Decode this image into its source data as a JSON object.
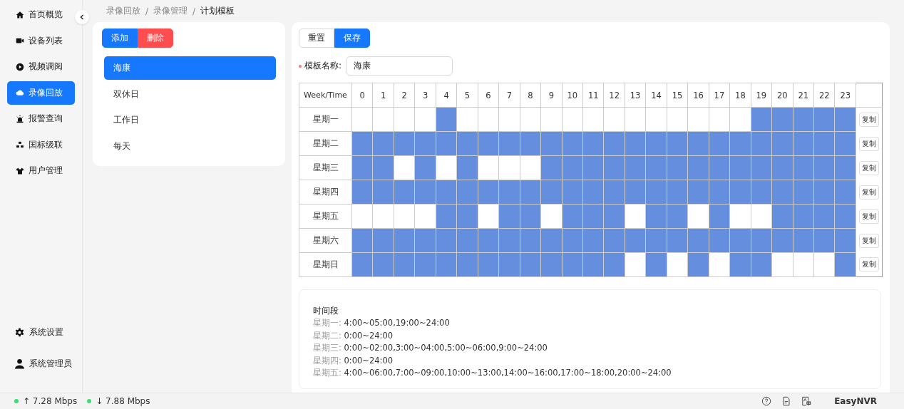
{
  "sidebar": {
    "items": [
      {
        "label": "首页概览",
        "selected": false
      },
      {
        "label": "设备列表",
        "selected": false
      },
      {
        "label": "视频调阅",
        "selected": false
      },
      {
        "label": "录像回放",
        "selected": true
      },
      {
        "label": "报警查询",
        "selected": false
      },
      {
        "label": "国标级联",
        "selected": false
      },
      {
        "label": "用户管理",
        "selected": false
      }
    ],
    "bottom_items": [
      {
        "label": "系统设置"
      },
      {
        "label": "系统管理员"
      }
    ]
  },
  "breadcrumb": [
    "录像回放",
    "/",
    "录像管理",
    "/",
    "计划模板"
  ],
  "template_list": {
    "buttons": [
      {
        "label": "添加",
        "kind": "primary"
      },
      {
        "label": "删除",
        "kind": "danger"
      }
    ],
    "items": [
      {
        "label": "海康",
        "selected": true
      },
      {
        "label": "双休日",
        "selected": false
      },
      {
        "label": "工作日",
        "selected": false
      },
      {
        "label": "每天",
        "selected": false
      }
    ]
  },
  "editor": {
    "buttons": [
      {
        "label": "重置",
        "kind": "default"
      },
      {
        "label": "保存",
        "kind": "primary"
      }
    ],
    "name_field": {
      "label": "模板名称:",
      "required": true,
      "value": "海康"
    },
    "schedule": {
      "corner": "Week/Time",
      "hours": [
        "0",
        "1",
        "2",
        "3",
        "4",
        "5",
        "6",
        "7",
        "8",
        "9",
        "10",
        "11",
        "12",
        "13",
        "14",
        "15",
        "16",
        "17",
        "18",
        "19",
        "20",
        "21",
        "22",
        "23"
      ],
      "rows": [
        {
          "day": "星期一",
          "copy": "复制",
          "slots": [
            false,
            false,
            false,
            false,
            true,
            false,
            false,
            false,
            false,
            false,
            false,
            false,
            false,
            false,
            false,
            false,
            false,
            false,
            false,
            true,
            true,
            true,
            true,
            true
          ]
        },
        {
          "day": "星期二",
          "copy": "复制",
          "slots": [
            true,
            true,
            true,
            true,
            true,
            true,
            true,
            true,
            true,
            true,
            true,
            true,
            true,
            true,
            true,
            true,
            true,
            true,
            true,
            true,
            true,
            true,
            true,
            true
          ]
        },
        {
          "day": "星期三",
          "copy": "复制",
          "slots": [
            true,
            true,
            false,
            true,
            false,
            true,
            false,
            false,
            false,
            true,
            true,
            true,
            true,
            true,
            true,
            true,
            true,
            true,
            true,
            true,
            true,
            true,
            true,
            true
          ]
        },
        {
          "day": "星期四",
          "copy": "复制",
          "slots": [
            true,
            true,
            true,
            true,
            true,
            true,
            true,
            true,
            true,
            true,
            true,
            true,
            true,
            true,
            true,
            true,
            true,
            true,
            true,
            true,
            true,
            true,
            true,
            true
          ]
        },
        {
          "day": "星期五",
          "copy": "复制",
          "slots": [
            false,
            false,
            false,
            false,
            true,
            true,
            false,
            true,
            true,
            false,
            true,
            true,
            true,
            false,
            true,
            true,
            false,
            true,
            false,
            false,
            true,
            true,
            true,
            true
          ]
        },
        {
          "day": "星期六",
          "copy": "复制",
          "slots": [
            true,
            true,
            true,
            true,
            true,
            true,
            true,
            true,
            true,
            true,
            true,
            true,
            true,
            true,
            true,
            true,
            true,
            true,
            true,
            true,
            true,
            true,
            true,
            true
          ]
        },
        {
          "day": "星期日",
          "copy": "复制",
          "slots": [
            true,
            true,
            true,
            true,
            true,
            true,
            true,
            true,
            true,
            true,
            true,
            true,
            true,
            false,
            true,
            false,
            true,
            false,
            true,
            true,
            false,
            false,
            false,
            true
          ]
        }
      ]
    },
    "summary": {
      "title": "时间段",
      "lines": [
        {
          "day": "星期一:",
          "ranges": "4:00~05:00,19:00~24:00"
        },
        {
          "day": "星期二:",
          "ranges": "0:00~24:00"
        },
        {
          "day": "星期三:",
          "ranges": "0:00~02:00,3:00~04:00,5:00~06:00,9:00~24:00"
        },
        {
          "day": "星期四:",
          "ranges": "0:00~24:00"
        },
        {
          "day": "星期五:",
          "ranges": "4:00~06:00,7:00~09:00,10:00~13:00,14:00~16:00,17:00~18:00,20:00~24:00"
        }
      ]
    }
  },
  "status_bar": {
    "upload": {
      "arrow": "↑",
      "rate": "7.28 Mbps",
      "color": "#3ddc6e"
    },
    "download": {
      "arrow": "↓",
      "rate": "7.88 Mbps",
      "color": "#3ddc6e"
    },
    "brand": "EasyNVR"
  }
}
